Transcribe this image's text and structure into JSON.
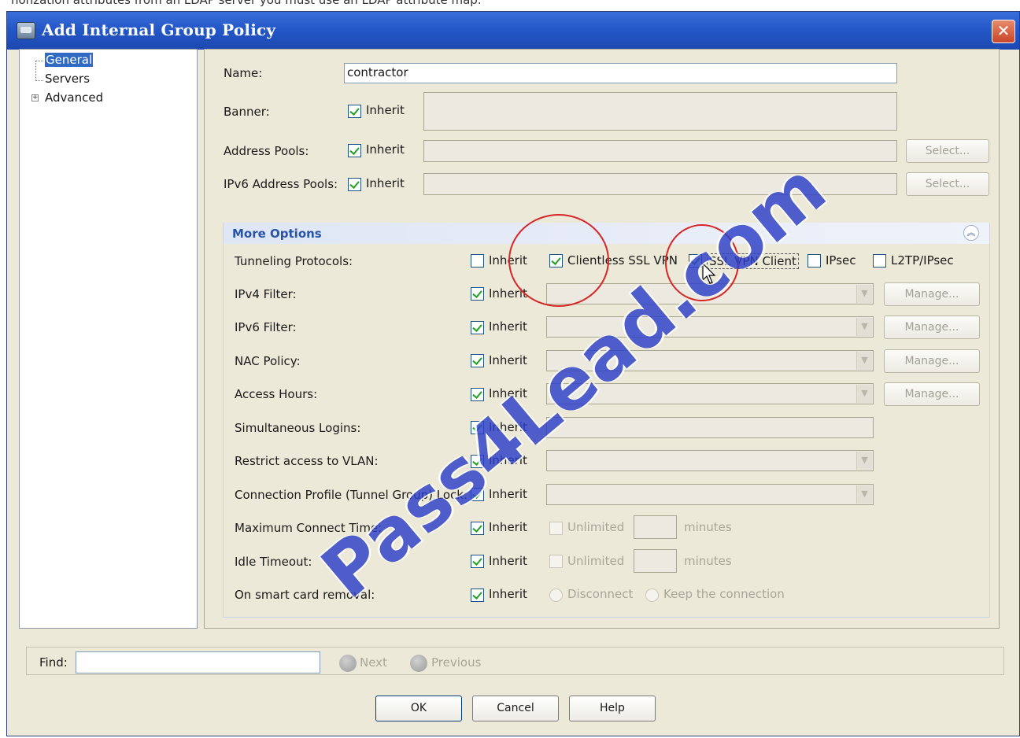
{
  "page_top_text": "nonzation attributes from an LDAP server you must use an LDAP attribute map.",
  "window": {
    "title": "Add Internal Group Policy",
    "close_glyph": "✕"
  },
  "tree": {
    "items": [
      {
        "label": "General",
        "selected": true
      },
      {
        "label": "Servers",
        "selected": false
      },
      {
        "label": "Advanced",
        "selected": false,
        "expandable": true
      }
    ]
  },
  "form": {
    "name_label": "Name:",
    "name_value": "contractor",
    "banner_label": "Banner:",
    "address_pools_label": "Address Pools:",
    "ipv6_address_pools_label": "IPv6 Address Pools:",
    "inherit_label": "Inherit",
    "select_label": "Select..."
  },
  "more_options": {
    "title": "More Options",
    "collapse_glyph": "︽",
    "tunneling": {
      "label": "Tunneling Protocols:",
      "protocols": [
        {
          "label": "Clientless SSL VPN",
          "checked": true
        },
        {
          "label": "SSL VPN Client",
          "checked": true
        },
        {
          "label": "IPsec",
          "checked": false
        },
        {
          "label": "L2TP/IPsec",
          "checked": false
        }
      ]
    },
    "rows": [
      {
        "label": "IPv4 Filter:",
        "manage": "Manage..."
      },
      {
        "label": "IPv6 Filter:",
        "manage": "Manage..."
      },
      {
        "label": "NAC Policy:",
        "manage": "Manage..."
      },
      {
        "label": "Access Hours:",
        "manage": "Manage..."
      },
      {
        "label": "Simultaneous Logins:"
      },
      {
        "label": "Restrict access to VLAN:"
      },
      {
        "label": "Connection Profile (Tunnel Group) Lock:"
      },
      {
        "label": "Maximum Connect Time:",
        "unlimited": "Unlimited",
        "unit": "minutes"
      },
      {
        "label": "Idle Timeout:",
        "unlimited": "Unlimited",
        "unit": "minutes"
      },
      {
        "label": "On smart card removal:",
        "option1": "Disconnect",
        "option2": "Keep the connection"
      }
    ]
  },
  "find": {
    "label": "Find:",
    "value": "",
    "next": "Next",
    "previous": "Previous"
  },
  "buttons": {
    "ok": "OK",
    "cancel": "Cancel",
    "help": "Help"
  },
  "watermark": "Pass4Lead.com",
  "colors": {
    "titlebar": "#2458c9",
    "dialog_bg": "#ece9d8",
    "section_title": "#2a55a6",
    "watermark": "#2c3fc8",
    "annotation": "#d62626"
  }
}
